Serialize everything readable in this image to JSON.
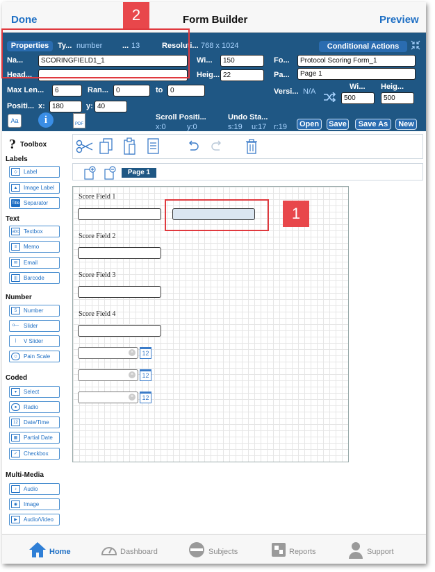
{
  "nav": {
    "done": "Done",
    "title": "Form Builder",
    "preview": "Preview"
  },
  "properties": {
    "properties_btn": "Properties",
    "type_label": "Ty...",
    "type_value": "number",
    "type_num_label": "...",
    "type_num": "13",
    "resolution_label": "Resoluti...",
    "resolution_value": "768 x 1024",
    "conditional_btn": "Conditional Actions",
    "name_label": "Na...",
    "name_value": "SCORINGFIELD1_1",
    "width_label": "Wi...",
    "width_value": "150",
    "form_label": "Fo...",
    "form_value": "Protocol Scoring Form_1",
    "heading_label": "Head...",
    "heading_value": "",
    "height_label": "Heig...",
    "height_value": "22",
    "page_label": "Pa...",
    "page_value": "Page 1",
    "maxlen_label": "Max Len...",
    "maxlen_value": "6",
    "range_label": "Ran...",
    "range_from": "0",
    "range_to_label": "to",
    "range_to": "0",
    "version_label": "Versi...",
    "version_value": "N/A",
    "w2_label": "Wi...",
    "w2_value": "500",
    "h2_label": "Heig...",
    "h2_value": "500",
    "position_label": "Positi...",
    "x_label": "x:",
    "x_value": "180",
    "y_label": "y:",
    "y_value": "40",
    "scroll_label": "Scroll Positi...",
    "scroll_x": "x:0",
    "scroll_y": "y:0",
    "undo_label": "Undo Sta...",
    "undo_s": "s:19",
    "undo_u": "u:17",
    "undo_r": "r:19",
    "open_btn": "Open",
    "save_btn": "Save",
    "saveas_btn": "Save As",
    "new_btn": "New",
    "aa_icon": "Aa",
    "info_icon": "i",
    "pdf_icon": "PDF"
  },
  "toolbox": {
    "title": "Toolbox",
    "categories": {
      "labels": "Labels",
      "text": "Text",
      "number": "Number",
      "coded": "Coded",
      "multimedia": "Multi-Media"
    },
    "items": {
      "label": "Label",
      "image_label": "Image Label",
      "separator": "Separator",
      "separator_icon": "Title",
      "textbox": "Textbox",
      "textbox_icon": "abc",
      "memo": "Memo",
      "email": "Email",
      "barcode": "Barcode",
      "number": "Number",
      "number_icon": "5",
      "slider": "Slider",
      "vslider": "V Slider",
      "pain": "Pain Scale",
      "select": "Select",
      "radio": "Radio",
      "datetime": "Date/Time",
      "datetime_icon": "12",
      "partial_date": "Partial Date",
      "checkbox": "Checkbox",
      "audio": "Audio",
      "image": "Image",
      "audio_video": "Audio/Video"
    }
  },
  "tabs": {
    "page1": "Page 1"
  },
  "canvas": {
    "fields": [
      "Score Field 1",
      "Score Field 2",
      "Score Field 3",
      "Score Field 4"
    ],
    "date_badge": "12"
  },
  "callouts": {
    "one": "1",
    "two": "2"
  },
  "bottom_nav": {
    "home": "Home",
    "dashboard": "Dashboard",
    "subjects": "Subjects",
    "reports": "Reports",
    "support": "Support"
  },
  "colors": {
    "header_bg": "#1f5784",
    "accent": "#1e6fc4",
    "callout": "#e8474b"
  }
}
